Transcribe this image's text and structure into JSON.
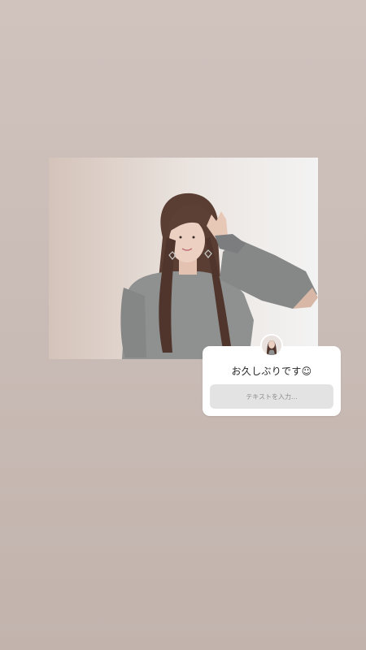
{
  "story": {
    "background_colors": [
      "#d0c2bd",
      "#c2b3ad"
    ]
  },
  "photo": {
    "icon": "portrait-photo"
  },
  "question_sticker": {
    "avatar_icon": "profile-avatar",
    "title": "お久しぶりです☺︎",
    "placeholder": "テキストを入力..."
  }
}
